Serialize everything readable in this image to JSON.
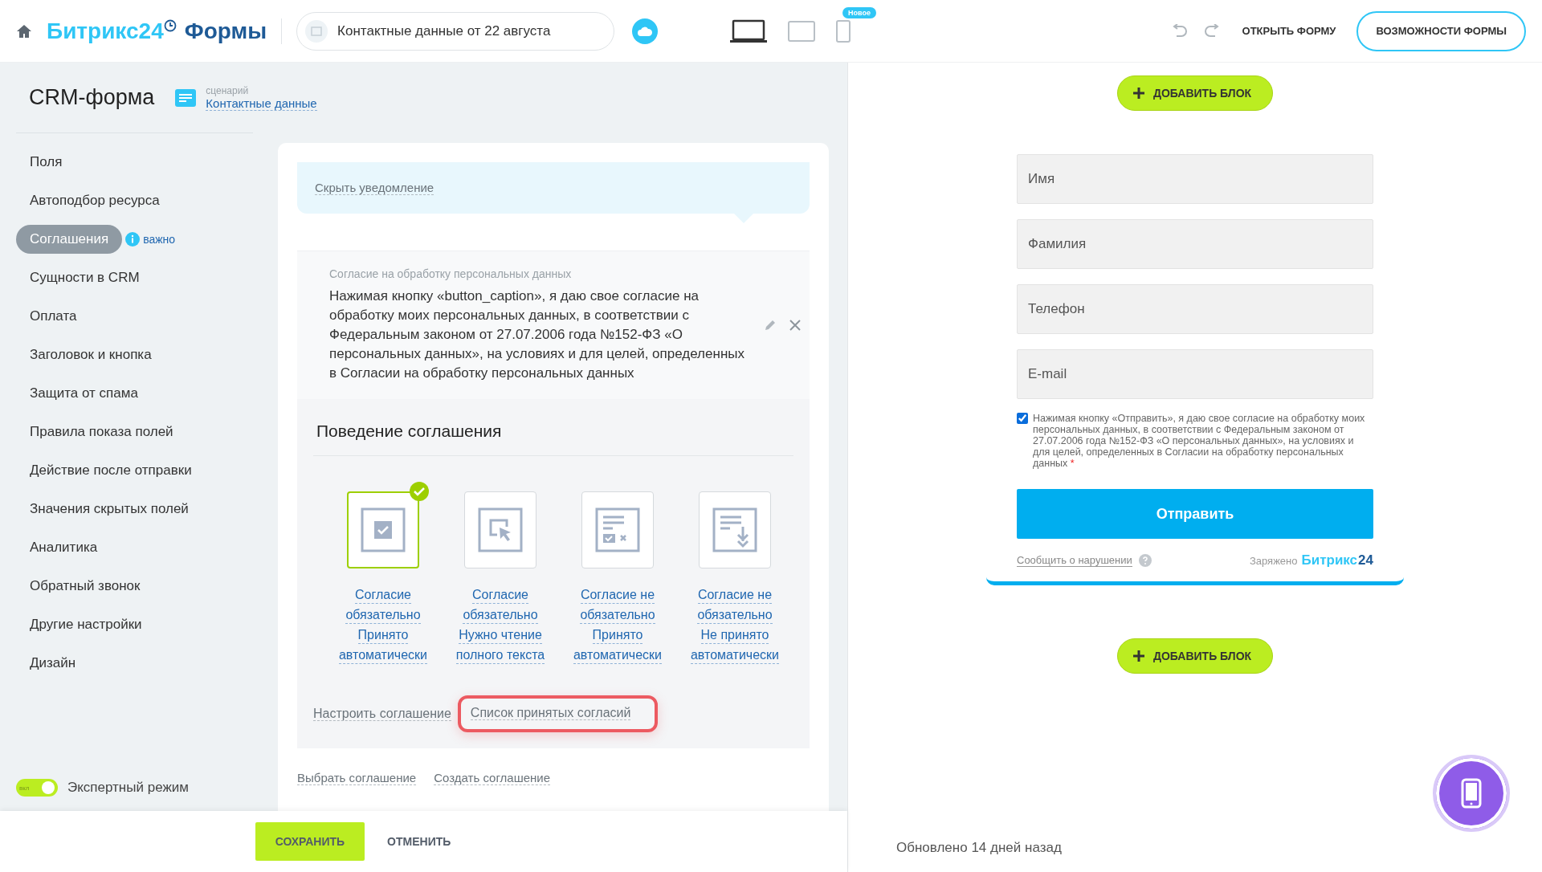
{
  "header": {
    "brand": "Битрикс24",
    "brand_suffix": "Формы",
    "form_name": "Контактные данные от 22 августа",
    "devices": [
      {
        "kind": "desktop",
        "selected": true
      },
      {
        "kind": "tablet",
        "selected": false
      },
      {
        "kind": "phone",
        "selected": false,
        "badge": "Новое"
      }
    ],
    "open_form": "ОТКРЫТЬ ФОРМУ",
    "features": "ВОЗМОЖНОСТИ ФОРМЫ"
  },
  "sidebar": {
    "title": "CRM-форма",
    "scenario_label": "сценарий",
    "scenario_value": "Контактные данные",
    "items": [
      {
        "label": "Поля",
        "selected": false
      },
      {
        "label": "Автоподбор ресурса",
        "selected": false
      },
      {
        "label": "Соглашения",
        "selected": true,
        "badge": "важно"
      },
      {
        "label": "Сущности в CRM",
        "selected": false
      },
      {
        "label": "Оплата",
        "selected": false
      },
      {
        "label": "Заголовок и кнопка",
        "selected": false
      },
      {
        "label": "Защита от спама",
        "selected": false
      },
      {
        "label": "Правила показа полей",
        "selected": false
      },
      {
        "label": "Действие после отправки",
        "selected": false
      },
      {
        "label": "Значения скрытых полей",
        "selected": false
      },
      {
        "label": "Аналитика",
        "selected": false
      },
      {
        "label": "Обратный звонок",
        "selected": false
      },
      {
        "label": "Другие настройки",
        "selected": false
      },
      {
        "label": "Дизайн",
        "selected": false
      }
    ],
    "expert_mode": {
      "label": "Экспертный режим",
      "toggle_text": "вкл",
      "on": true
    }
  },
  "content": {
    "hide_notice": "Скрыть уведомление",
    "agreement": {
      "title": "Согласие на обработку персональных данных",
      "text": "Нажимая кнопку «button_caption», я даю свое согласие на обработку моих персональных данных, в соответствии с Федеральным законом от 27.07.2006 года №152-ФЗ «О персональных данных», на условиях и для целей, определенных в Согласии на обработку персональных данных"
    },
    "behaviour": {
      "title": "Поведение соглашения",
      "options": [
        {
          "kind": "checkbox",
          "lines": [
            "Согласие",
            "обязательно",
            "Принято",
            "автоматически"
          ],
          "selected": true
        },
        {
          "kind": "cursor",
          "lines": [
            "Согласие",
            "обязательно",
            "Нужно чтение",
            "полного текста"
          ],
          "selected": false
        },
        {
          "kind": "doc-check",
          "lines": [
            "Согласие не",
            "обязательно",
            "Принято",
            "автоматически"
          ],
          "selected": false
        },
        {
          "kind": "doc-download",
          "lines": [
            "Согласие не",
            "обязательно",
            "Не принято",
            "автоматически"
          ],
          "selected": false
        }
      ],
      "links": [
        {
          "text": "Настроить соглашение",
          "highlighted": false
        },
        {
          "text": "Список принятых согласий",
          "highlighted": true
        }
      ]
    },
    "bottom_links": [
      "Выбрать соглашение",
      "Создать соглашение"
    ]
  },
  "footer": {
    "save": "СОХРАНИТЬ",
    "cancel": "ОТМЕНИТЬ"
  },
  "preview": {
    "add_block": "ДОБАВИТЬ БЛОК",
    "fields": [
      {
        "placeholder": "Имя"
      },
      {
        "placeholder": "Фамилия"
      },
      {
        "placeholder": "Телефон"
      },
      {
        "placeholder": "E-mail"
      }
    ],
    "consent": {
      "checked": true,
      "text": "Нажимая кнопку «Отправить», я даю свое согласие на обработку моих персональных данных, в соответствии с Федеральным законом от 27.07.2006 года №152-ФЗ «О персональных данных», на условиях и для целей, определенных в Согласии на обработку персональных данных",
      "required_mark": "*"
    },
    "submit": "Отправить",
    "report": "Сообщить о нарушении",
    "powered_prefix": "Заряжено",
    "powered_brand": "Битрикс",
    "powered_num": "24",
    "add_block_bottom": "ДОБАВИТЬ БЛОК",
    "updated": "Обновлено 14 дней назад"
  }
}
